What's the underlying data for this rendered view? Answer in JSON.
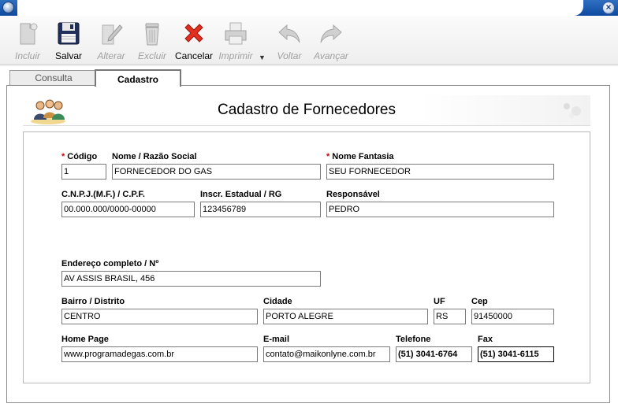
{
  "window": {
    "close_glyph": "×"
  },
  "toolbar": {
    "items": [
      {
        "id": "incluir",
        "label": "Incluir",
        "enabled": false,
        "icon": "new-document-icon"
      },
      {
        "id": "salvar",
        "label": "Salvar",
        "enabled": true,
        "icon": "floppy-disk-icon"
      },
      {
        "id": "alterar",
        "label": "Alterar",
        "enabled": false,
        "icon": "edit-pencil-icon"
      },
      {
        "id": "excluir",
        "label": "Excluir",
        "enabled": false,
        "icon": "trash-can-icon"
      },
      {
        "id": "cancelar",
        "label": "Cancelar",
        "enabled": true,
        "icon": "red-x-icon"
      },
      {
        "id": "imprimir",
        "label": "Imprimir",
        "enabled": false,
        "icon": "printer-icon"
      },
      {
        "id": "voltar",
        "label": "Voltar",
        "enabled": false,
        "icon": "arrow-back-icon"
      },
      {
        "id": "avancar",
        "label": "Avançar",
        "enabled": false,
        "icon": "arrow-forward-icon"
      }
    ],
    "dropdown_glyph": "▼"
  },
  "tabs": [
    {
      "label": "Consulta",
      "active": false
    },
    {
      "label": "Cadastro",
      "active": true
    }
  ],
  "banner": {
    "title": "Cadastro de Fornecedores"
  },
  "form": {
    "codigo": {
      "label": "Código",
      "value": "1",
      "required": true
    },
    "nome_razao": {
      "label": "Nome / Razão Social",
      "value": "FORNECEDOR DO GAS"
    },
    "nome_fantasia": {
      "label": "Nome Fantasia",
      "value": "SEU FORNECEDOR",
      "required": true
    },
    "cnpj": {
      "label": "C.N.P.J.(M.F.) / C.P.F.",
      "value": "00.000.000/0000-00000"
    },
    "inscr_estadual": {
      "label": "Inscr. Estadual / RG",
      "value": "123456789"
    },
    "responsavel": {
      "label": "Responsável",
      "value": "PEDRO"
    },
    "endereco": {
      "label": "Endereço completo / Nº",
      "value": "AV ASSIS BRASIL, 456"
    },
    "bairro": {
      "label": "Bairro / Distrito",
      "value": "CENTRO"
    },
    "cidade": {
      "label": "Cidade",
      "value": "PORTO ALEGRE"
    },
    "uf": {
      "label": "UF",
      "value": "RS"
    },
    "cep": {
      "label": "Cep",
      "value": "91450000"
    },
    "home_page": {
      "label": "Home Page",
      "value": "www.programadegas.com.br"
    },
    "email": {
      "label": "E-mail",
      "value": "contato@maikonlyne.com.br"
    },
    "telefone": {
      "label": "Telefone",
      "value": "(51) 3041-6764"
    },
    "fax": {
      "label": "Fax",
      "value": "(51) 3041-6115"
    }
  },
  "required_marker": "*",
  "colors": {
    "titlebar": "#0d4aa0",
    "required": "#d00000",
    "cancel": "#e03020"
  }
}
